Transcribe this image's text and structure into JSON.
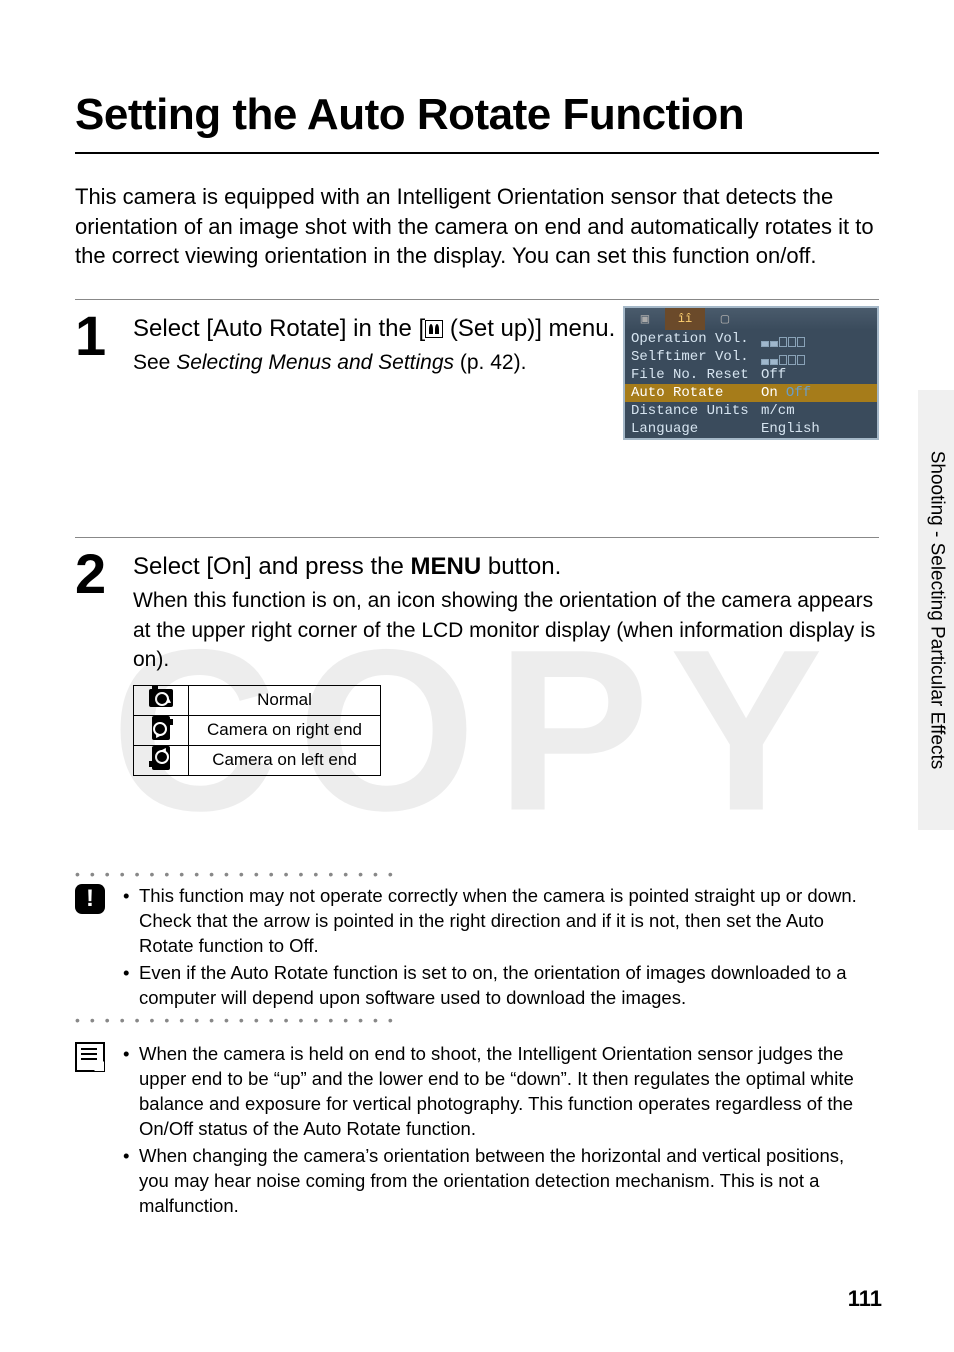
{
  "title": "Setting the Auto Rotate Function",
  "intro": "This camera is equipped with an Intelligent Orientation sensor that detects the orientation of an image shot with the camera on end and automatically rotates it to the correct viewing orientation in the display. You can set this function on/off.",
  "steps": [
    {
      "num": "1",
      "heading_pre": "Select [Auto Rotate] in the [",
      "heading_post": " (Set up)] menu.",
      "text_pre": "See ",
      "text_em": "Selecting Menus and Settings",
      "text_post": " (p. 42)."
    },
    {
      "num": "2",
      "heading_pre": "Select [On] and press the ",
      "heading_bold": "MENU",
      "heading_post": " button.",
      "text": "When this function is on, an icon showing the orientation of the camera appears at the upper right corner of the LCD monitor display (when information display is on)."
    }
  ],
  "menu": {
    "rows": [
      {
        "k": "Operation Vol.",
        "type": "vol"
      },
      {
        "k": "Selftimer Vol.",
        "type": "vol"
      },
      {
        "k": "File No. Reset",
        "v": "Off"
      },
      {
        "k": "Auto Rotate",
        "type": "onoff",
        "on": "On",
        "off": "Off",
        "highlight": true
      },
      {
        "k": "Distance Units",
        "v": "m/cm"
      },
      {
        "k": "Language",
        "v": "English"
      }
    ]
  },
  "orient_table": [
    {
      "icon": "normal",
      "label": "Normal"
    },
    {
      "icon": "right",
      "label": "Camera on right end"
    },
    {
      "icon": "left",
      "label": "Camera on left end"
    }
  ],
  "warn_notes": [
    "This function may not operate correctly when the camera is pointed straight up or down. Check that the arrow is pointed in the right direction and if it is not, then set the Auto Rotate function to Off.",
    "Even if the Auto Rotate function is set to on, the orientation of images downloaded to a computer will depend upon software used to download the images."
  ],
  "info_notes": [
    "When the camera is held on end to shoot, the Intelligent Orientation sensor judges the upper end to be “up” and the lower end to be “down”. It then regulates the optimal white balance and exposure for vertical photography. This function operates regardless of the On/Off status of the Auto Rotate function.",
    "When changing the camera’s orientation between the horizontal and vertical positions, you may hear noise coming from the orientation detection mechanism. This is not a malfunction."
  ],
  "side_tab": "Shooting - Selecting Particular Effects",
  "page_num": "111",
  "watermark": "COPY"
}
